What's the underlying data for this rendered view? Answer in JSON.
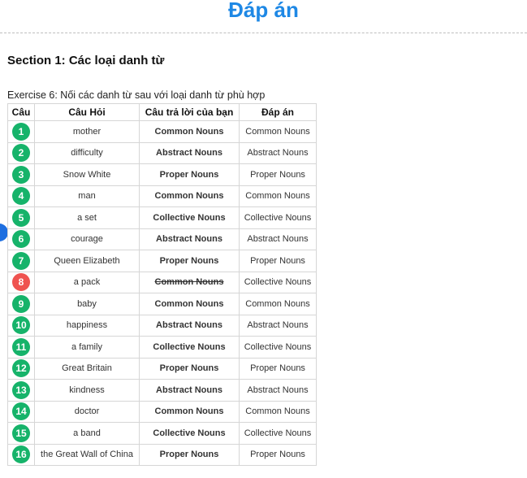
{
  "page": {
    "title": "Đáp án",
    "section_title": "Section 1: Các loại danh từ",
    "exercise_title": "Exercise 6: Nối các danh từ sau với loại danh từ phù hợp"
  },
  "table": {
    "headers": {
      "number": "Câu",
      "question": "Câu Hỏi",
      "user_answer": "Câu trả lời của bạn",
      "correct_answer": "Đáp án"
    },
    "rows": [
      {
        "num": "1",
        "question": "mother",
        "user_answer": "Common Nouns",
        "correct_answer": "Common Nouns",
        "correct": true
      },
      {
        "num": "2",
        "question": "difficulty",
        "user_answer": "Abstract Nouns",
        "correct_answer": "Abstract Nouns",
        "correct": true
      },
      {
        "num": "3",
        "question": "Snow White",
        "user_answer": "Proper Nouns",
        "correct_answer": "Proper Nouns",
        "correct": true
      },
      {
        "num": "4",
        "question": "man",
        "user_answer": "Common Nouns",
        "correct_answer": "Common Nouns",
        "correct": true
      },
      {
        "num": "5",
        "question": "a set",
        "user_answer": "Collective Nouns",
        "correct_answer": "Collective Nouns",
        "correct": true
      },
      {
        "num": "6",
        "question": "courage",
        "user_answer": "Abstract Nouns",
        "correct_answer": "Abstract Nouns",
        "correct": true
      },
      {
        "num": "7",
        "question": "Queen Elizabeth",
        "user_answer": "Proper Nouns",
        "correct_answer": "Proper Nouns",
        "correct": true
      },
      {
        "num": "8",
        "question": "a pack",
        "user_answer": "Common Nouns",
        "correct_answer": "Collective Nouns",
        "correct": false
      },
      {
        "num": "9",
        "question": "baby",
        "user_answer": "Common Nouns",
        "correct_answer": "Common Nouns",
        "correct": true
      },
      {
        "num": "10",
        "question": "happiness",
        "user_answer": "Abstract Nouns",
        "correct_answer": "Abstract Nouns",
        "correct": true
      },
      {
        "num": "11",
        "question": "a family",
        "user_answer": "Collective Nouns",
        "correct_answer": "Collective Nouns",
        "correct": true
      },
      {
        "num": "12",
        "question": "Great Britain",
        "user_answer": "Proper Nouns",
        "correct_answer": "Proper Nouns",
        "correct": true
      },
      {
        "num": "13",
        "question": "kindness",
        "user_answer": "Abstract Nouns",
        "correct_answer": "Abstract Nouns",
        "correct": true
      },
      {
        "num": "14",
        "question": "doctor",
        "user_answer": "Common Nouns",
        "correct_answer": "Common Nouns",
        "correct": true
      },
      {
        "num": "15",
        "question": "a band",
        "user_answer": "Collective Nouns",
        "correct_answer": "Collective Nouns",
        "correct": true
      },
      {
        "num": "16",
        "question": "the Great Wall of China",
        "user_answer": "Proper Nouns",
        "correct_answer": "Proper Nouns",
        "correct": true
      }
    ]
  },
  "colors": {
    "title": "#1e88e5",
    "badge_correct": "#16b36a",
    "badge_wrong": "#ef5350",
    "side_dot": "#1e6fe0"
  }
}
